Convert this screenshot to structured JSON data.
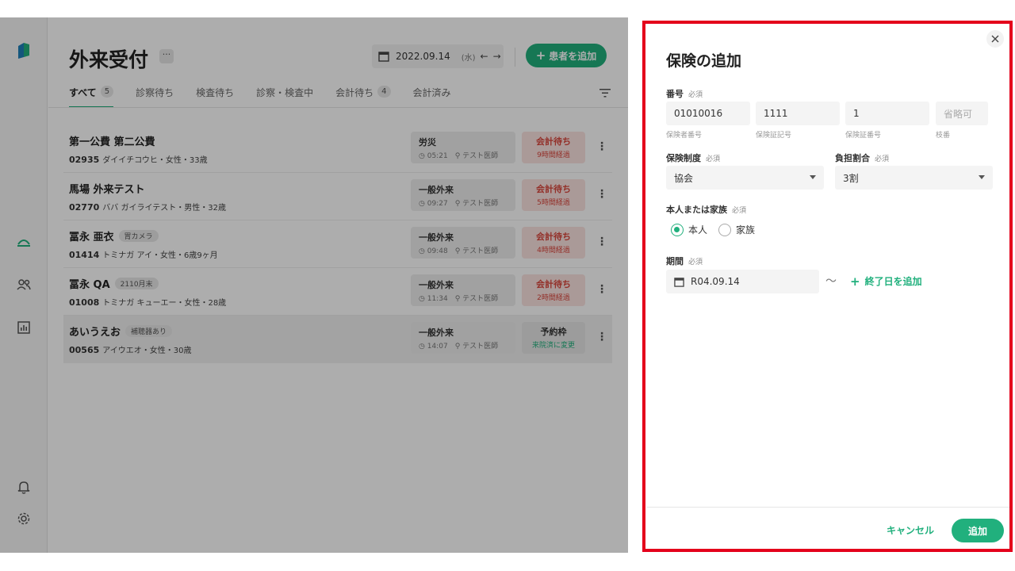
{
  "colors": {
    "accent": "#21b07d",
    "danger": "#d9463c",
    "frame": "#e4001b"
  },
  "header": {
    "title": "外来受付",
    "more_label": "···",
    "date": "2022.09.14",
    "weekday": "(水)",
    "prev_label": "←",
    "next_label": "→",
    "add_patient_label": "患者を追加"
  },
  "tabs": [
    {
      "label": "すべて",
      "count": "5"
    },
    {
      "label": "診察待ち"
    },
    {
      "label": "検査待ち"
    },
    {
      "label": "診察・検査中"
    },
    {
      "label": "会計待ち",
      "count": "4"
    },
    {
      "label": "会計済み"
    }
  ],
  "patients": [
    {
      "name": "第一公費 第二公費",
      "tag": "",
      "id": "02935",
      "info": "ダイイチコウヒ・女性・33歳",
      "visit": "労災",
      "time": "05:21",
      "doctor": "テスト医師",
      "status": "会計待ち",
      "status_sub": "9時間経過"
    },
    {
      "name": "馬場 外来テスト",
      "tag": "",
      "id": "02770",
      "info": "ババ ガイライテスト・男性・32歳",
      "visit": "一般外来",
      "time": "09:27",
      "doctor": "テスト医師",
      "status": "会計待ち",
      "status_sub": "5時間経過"
    },
    {
      "name": "冨永 亜衣",
      "tag": "胃カメラ",
      "id": "01414",
      "info": "トミナガ アイ・女性・6歳9ヶ月",
      "visit": "一般外来",
      "time": "09:48",
      "doctor": "テスト医師",
      "status": "会計待ち",
      "status_sub": "4時間経過"
    },
    {
      "name": "冨永 QA",
      "tag": "2110月末",
      "id": "01008",
      "info": "トミナガ キューエー・女性・28歳",
      "visit": "一般外来",
      "time": "11:34",
      "doctor": "テスト医師",
      "status": "会計待ち",
      "status_sub": "2時間経過"
    },
    {
      "name": "あいうえお",
      "tag": "補聴器あり",
      "id": "00565",
      "info": "アイウエオ・女性・30歳",
      "visit": "一般外来",
      "time": "14:07",
      "doctor": "テスト医師",
      "status": "予約枠",
      "status_sub": "来院済に変更"
    }
  ],
  "drawer": {
    "title": "保険の追加",
    "number_label": "番号",
    "required": "必須",
    "fields": {
      "insurer_no": {
        "value": "01010016",
        "caption": "保険者番号"
      },
      "card_symbol": {
        "value": "1111",
        "caption": "保険証記号"
      },
      "card_number": {
        "value": "1",
        "caption": "保険証番号"
      },
      "branch": {
        "placeholder": "省略可",
        "caption": "枝番"
      }
    },
    "system_label": "保険制度",
    "system_value": "協会",
    "burden_label": "負担割合",
    "burden_value": "3割",
    "relation_label": "本人または家族",
    "relation_options": [
      "本人",
      "家族"
    ],
    "period_label": "期間",
    "period_start": "R04.09.14",
    "tilde": "〜",
    "add_end_label": "終了日を追加",
    "cancel_label": "キャンセル",
    "submit_label": "追加"
  }
}
